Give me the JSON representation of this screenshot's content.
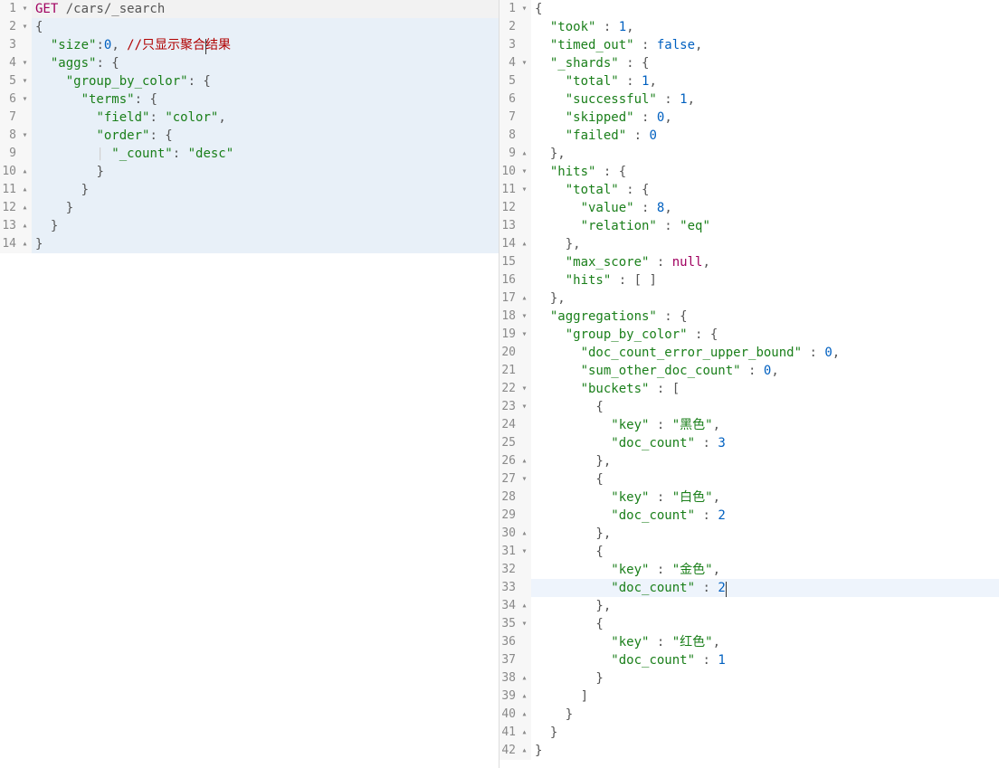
{
  "left": {
    "toolbar": {
      "runTitle": "run-query",
      "wrenchTitle": "tools"
    },
    "lines": [
      {
        "num": "1",
        "fold": "▾",
        "tokens": [
          {
            "cls": "method",
            "t": "GET "
          },
          {
            "cls": "punc",
            "t": "/cars/_search"
          }
        ]
      },
      {
        "num": "2",
        "fold": "▾",
        "hl": true,
        "tokens": [
          {
            "cls": "punc",
            "t": "{"
          }
        ]
      },
      {
        "num": "3",
        "fold": " ",
        "hl": true,
        "tokens": [
          {
            "cls": "punc",
            "t": "  "
          },
          {
            "cls": "key",
            "t": "\"size\""
          },
          {
            "cls": "punc",
            "t": ":"
          },
          {
            "cls": "num",
            "t": "0"
          },
          {
            "cls": "punc",
            "t": ", "
          },
          {
            "cls": "comment",
            "t": "//只显示聚合"
          },
          {
            "cls": "comment caretpoint",
            "t": "结果"
          }
        ],
        "caretAfter": 7
      },
      {
        "num": "4",
        "fold": "▾",
        "hl": true,
        "tokens": [
          {
            "cls": "punc",
            "t": "  "
          },
          {
            "cls": "key",
            "t": "\"aggs\""
          },
          {
            "cls": "punc",
            "t": ": {"
          }
        ]
      },
      {
        "num": "5",
        "fold": "▾",
        "hl": true,
        "tokens": [
          {
            "cls": "punc",
            "t": "    "
          },
          {
            "cls": "key",
            "t": "\"group_by_color\""
          },
          {
            "cls": "punc",
            "t": ": {"
          }
        ]
      },
      {
        "num": "6",
        "fold": "▾",
        "hl": true,
        "tokens": [
          {
            "cls": "punc",
            "t": "      "
          },
          {
            "cls": "key",
            "t": "\"terms\""
          },
          {
            "cls": "punc",
            "t": ": {"
          }
        ]
      },
      {
        "num": "7",
        "fold": " ",
        "hl": true,
        "tokens": [
          {
            "cls": "punc",
            "t": "        "
          },
          {
            "cls": "key",
            "t": "\"field\""
          },
          {
            "cls": "punc",
            "t": ": "
          },
          {
            "cls": "str",
            "t": "\"color\""
          },
          {
            "cls": "punc",
            "t": ","
          }
        ]
      },
      {
        "num": "8",
        "fold": "▾",
        "hl": true,
        "tokens": [
          {
            "cls": "punc",
            "t": "        "
          },
          {
            "cls": "key",
            "t": "\"order\""
          },
          {
            "cls": "punc",
            "t": ": {"
          }
        ]
      },
      {
        "num": "9",
        "fold": " ",
        "hl": true,
        "tokens": [
          {
            "cls": "indent-guide",
            "t": "        | "
          },
          {
            "cls": "key",
            "t": "\"_count\""
          },
          {
            "cls": "punc",
            "t": ": "
          },
          {
            "cls": "str",
            "t": "\"desc\""
          }
        ]
      },
      {
        "num": "10",
        "fold": "▴",
        "hl": true,
        "tokens": [
          {
            "cls": "indent-guide",
            "t": "        "
          },
          {
            "cls": "punc",
            "t": "}"
          }
        ]
      },
      {
        "num": "11",
        "fold": "▴",
        "hl": true,
        "tokens": [
          {
            "cls": "indent-guide",
            "t": "      "
          },
          {
            "cls": "punc",
            "t": "}"
          }
        ]
      },
      {
        "num": "12",
        "fold": "▴",
        "hl": true,
        "tokens": [
          {
            "cls": "indent-guide",
            "t": "    "
          },
          {
            "cls": "punc",
            "t": "}"
          }
        ]
      },
      {
        "num": "13",
        "fold": "▴",
        "hl": true,
        "tokens": [
          {
            "cls": "indent-guide",
            "t": "  "
          },
          {
            "cls": "punc",
            "t": "}"
          }
        ]
      },
      {
        "num": "14",
        "fold": "▴",
        "hl": true,
        "tokens": [
          {
            "cls": "punc",
            "t": "}"
          }
        ]
      }
    ]
  },
  "right": {
    "lines": [
      {
        "num": "1",
        "fold": "▾",
        "tokens": [
          {
            "cls": "punc",
            "t": "{"
          }
        ]
      },
      {
        "num": "2",
        "fold": " ",
        "tokens": [
          {
            "cls": "punc",
            "t": "  "
          },
          {
            "cls": "key",
            "t": "\"took\""
          },
          {
            "cls": "punc",
            "t": " : "
          },
          {
            "cls": "num",
            "t": "1"
          },
          {
            "cls": "punc",
            "t": ","
          }
        ]
      },
      {
        "num": "3",
        "fold": " ",
        "tokens": [
          {
            "cls": "punc",
            "t": "  "
          },
          {
            "cls": "key",
            "t": "\"timed_out\""
          },
          {
            "cls": "punc",
            "t": " : "
          },
          {
            "cls": "kw",
            "t": "false"
          },
          {
            "cls": "punc",
            "t": ","
          }
        ]
      },
      {
        "num": "4",
        "fold": "▾",
        "tokens": [
          {
            "cls": "punc",
            "t": "  "
          },
          {
            "cls": "key",
            "t": "\"_shards\""
          },
          {
            "cls": "punc",
            "t": " : {"
          }
        ]
      },
      {
        "num": "5",
        "fold": " ",
        "tokens": [
          {
            "cls": "punc",
            "t": "    "
          },
          {
            "cls": "key",
            "t": "\"total\""
          },
          {
            "cls": "punc",
            "t": " : "
          },
          {
            "cls": "num",
            "t": "1"
          },
          {
            "cls": "punc",
            "t": ","
          }
        ]
      },
      {
        "num": "6",
        "fold": " ",
        "tokens": [
          {
            "cls": "punc",
            "t": "    "
          },
          {
            "cls": "key",
            "t": "\"successful\""
          },
          {
            "cls": "punc",
            "t": " : "
          },
          {
            "cls": "num",
            "t": "1"
          },
          {
            "cls": "punc",
            "t": ","
          }
        ]
      },
      {
        "num": "7",
        "fold": " ",
        "tokens": [
          {
            "cls": "punc",
            "t": "    "
          },
          {
            "cls": "key",
            "t": "\"skipped\""
          },
          {
            "cls": "punc",
            "t": " : "
          },
          {
            "cls": "num",
            "t": "0"
          },
          {
            "cls": "punc",
            "t": ","
          }
        ]
      },
      {
        "num": "8",
        "fold": " ",
        "tokens": [
          {
            "cls": "punc",
            "t": "    "
          },
          {
            "cls": "key",
            "t": "\"failed\""
          },
          {
            "cls": "punc",
            "t": " : "
          },
          {
            "cls": "num",
            "t": "0"
          }
        ]
      },
      {
        "num": "9",
        "fold": "▴",
        "tokens": [
          {
            "cls": "punc",
            "t": "  },"
          }
        ]
      },
      {
        "num": "10",
        "fold": "▾",
        "tokens": [
          {
            "cls": "punc",
            "t": "  "
          },
          {
            "cls": "key",
            "t": "\"hits\""
          },
          {
            "cls": "punc",
            "t": " : {"
          }
        ]
      },
      {
        "num": "11",
        "fold": "▾",
        "tokens": [
          {
            "cls": "punc",
            "t": "    "
          },
          {
            "cls": "key",
            "t": "\"total\""
          },
          {
            "cls": "punc",
            "t": " : {"
          }
        ]
      },
      {
        "num": "12",
        "fold": " ",
        "tokens": [
          {
            "cls": "punc",
            "t": "      "
          },
          {
            "cls": "key",
            "t": "\"value\""
          },
          {
            "cls": "punc",
            "t": " : "
          },
          {
            "cls": "num",
            "t": "8"
          },
          {
            "cls": "punc",
            "t": ","
          }
        ]
      },
      {
        "num": "13",
        "fold": " ",
        "tokens": [
          {
            "cls": "punc",
            "t": "      "
          },
          {
            "cls": "key",
            "t": "\"relation\""
          },
          {
            "cls": "punc",
            "t": " : "
          },
          {
            "cls": "str",
            "t": "\"eq\""
          }
        ]
      },
      {
        "num": "14",
        "fold": "▴",
        "tokens": [
          {
            "cls": "punc",
            "t": "    },"
          }
        ]
      },
      {
        "num": "15",
        "fold": " ",
        "tokens": [
          {
            "cls": "punc",
            "t": "    "
          },
          {
            "cls": "key",
            "t": "\"max_score\""
          },
          {
            "cls": "punc",
            "t": " : "
          },
          {
            "cls": "nullkw",
            "t": "null"
          },
          {
            "cls": "punc",
            "t": ","
          }
        ]
      },
      {
        "num": "16",
        "fold": " ",
        "tokens": [
          {
            "cls": "punc",
            "t": "    "
          },
          {
            "cls": "key",
            "t": "\"hits\""
          },
          {
            "cls": "punc",
            "t": " : [ ]"
          }
        ]
      },
      {
        "num": "17",
        "fold": "▴",
        "tokens": [
          {
            "cls": "punc",
            "t": "  },"
          }
        ]
      },
      {
        "num": "18",
        "fold": "▾",
        "tokens": [
          {
            "cls": "punc",
            "t": "  "
          },
          {
            "cls": "key",
            "t": "\"aggregations\""
          },
          {
            "cls": "punc",
            "t": " : {"
          }
        ]
      },
      {
        "num": "19",
        "fold": "▾",
        "tokens": [
          {
            "cls": "punc",
            "t": "    "
          },
          {
            "cls": "key",
            "t": "\"group_by_color\""
          },
          {
            "cls": "punc",
            "t": " : {"
          }
        ]
      },
      {
        "num": "20",
        "fold": " ",
        "tokens": [
          {
            "cls": "punc",
            "t": "      "
          },
          {
            "cls": "key",
            "t": "\"doc_count_error_upper_bound\""
          },
          {
            "cls": "punc",
            "t": " : "
          },
          {
            "cls": "num",
            "t": "0"
          },
          {
            "cls": "punc",
            "t": ","
          }
        ]
      },
      {
        "num": "21",
        "fold": " ",
        "tokens": [
          {
            "cls": "punc",
            "t": "      "
          },
          {
            "cls": "key",
            "t": "\"sum_other_doc_count\""
          },
          {
            "cls": "punc",
            "t": " : "
          },
          {
            "cls": "num",
            "t": "0"
          },
          {
            "cls": "punc",
            "t": ","
          }
        ]
      },
      {
        "num": "22",
        "fold": "▾",
        "tokens": [
          {
            "cls": "punc",
            "t": "      "
          },
          {
            "cls": "key",
            "t": "\"buckets\""
          },
          {
            "cls": "punc",
            "t": " : ["
          }
        ]
      },
      {
        "num": "23",
        "fold": "▾",
        "tokens": [
          {
            "cls": "punc",
            "t": "        {"
          }
        ]
      },
      {
        "num": "24",
        "fold": " ",
        "tokens": [
          {
            "cls": "punc",
            "t": "          "
          },
          {
            "cls": "key",
            "t": "\"key\""
          },
          {
            "cls": "punc",
            "t": " : "
          },
          {
            "cls": "str",
            "t": "\"黑色\""
          },
          {
            "cls": "punc",
            "t": ","
          }
        ]
      },
      {
        "num": "25",
        "fold": " ",
        "tokens": [
          {
            "cls": "punc",
            "t": "          "
          },
          {
            "cls": "key",
            "t": "\"doc_count\""
          },
          {
            "cls": "punc",
            "t": " : "
          },
          {
            "cls": "num",
            "t": "3"
          }
        ]
      },
      {
        "num": "26",
        "fold": "▴",
        "tokens": [
          {
            "cls": "punc",
            "t": "        },"
          }
        ]
      },
      {
        "num": "27",
        "fold": "▾",
        "tokens": [
          {
            "cls": "punc",
            "t": "        {"
          }
        ]
      },
      {
        "num": "28",
        "fold": " ",
        "tokens": [
          {
            "cls": "punc",
            "t": "          "
          },
          {
            "cls": "key",
            "t": "\"key\""
          },
          {
            "cls": "punc",
            "t": " : "
          },
          {
            "cls": "str",
            "t": "\"白色\""
          },
          {
            "cls": "punc",
            "t": ","
          }
        ]
      },
      {
        "num": "29",
        "fold": " ",
        "tokens": [
          {
            "cls": "punc",
            "t": "          "
          },
          {
            "cls": "key",
            "t": "\"doc_count\""
          },
          {
            "cls": "punc",
            "t": " : "
          },
          {
            "cls": "num",
            "t": "2"
          }
        ]
      },
      {
        "num": "30",
        "fold": "▴",
        "tokens": [
          {
            "cls": "punc",
            "t": "        },"
          }
        ]
      },
      {
        "num": "31",
        "fold": "▾",
        "tokens": [
          {
            "cls": "punc",
            "t": "        {"
          }
        ]
      },
      {
        "num": "32",
        "fold": " ",
        "tokens": [
          {
            "cls": "punc",
            "t": "          "
          },
          {
            "cls": "key",
            "t": "\"key\""
          },
          {
            "cls": "punc",
            "t": " : "
          },
          {
            "cls": "str",
            "t": "\"金色\""
          },
          {
            "cls": "punc",
            "t": ","
          }
        ]
      },
      {
        "num": "33",
        "fold": " ",
        "hl": true,
        "tokens": [
          {
            "cls": "punc",
            "t": "          "
          },
          {
            "cls": "key",
            "t": "\"doc_count\""
          },
          {
            "cls": "punc",
            "t": " : "
          },
          {
            "cls": "num",
            "t": "2"
          }
        ],
        "caretEnd": true
      },
      {
        "num": "34",
        "fold": "▴",
        "tokens": [
          {
            "cls": "punc",
            "t": "        },"
          }
        ]
      },
      {
        "num": "35",
        "fold": "▾",
        "tokens": [
          {
            "cls": "punc",
            "t": "        {"
          }
        ]
      },
      {
        "num": "36",
        "fold": " ",
        "tokens": [
          {
            "cls": "punc",
            "t": "          "
          },
          {
            "cls": "key",
            "t": "\"key\""
          },
          {
            "cls": "punc",
            "t": " : "
          },
          {
            "cls": "str",
            "t": "\"红色\""
          },
          {
            "cls": "punc",
            "t": ","
          }
        ]
      },
      {
        "num": "37",
        "fold": " ",
        "tokens": [
          {
            "cls": "punc",
            "t": "          "
          },
          {
            "cls": "key",
            "t": "\"doc_count\""
          },
          {
            "cls": "punc",
            "t": " : "
          },
          {
            "cls": "num",
            "t": "1"
          }
        ]
      },
      {
        "num": "38",
        "fold": "▴",
        "tokens": [
          {
            "cls": "punc",
            "t": "        }"
          }
        ]
      },
      {
        "num": "39",
        "fold": "▴",
        "tokens": [
          {
            "cls": "punc",
            "t": "      ]"
          }
        ]
      },
      {
        "num": "40",
        "fold": "▴",
        "tokens": [
          {
            "cls": "punc",
            "t": "    }"
          }
        ]
      },
      {
        "num": "41",
        "fold": "▴",
        "tokens": [
          {
            "cls": "punc",
            "t": "  }"
          }
        ]
      },
      {
        "num": "42",
        "fold": "▴",
        "tokens": [
          {
            "cls": "punc",
            "t": "}"
          }
        ]
      }
    ]
  }
}
